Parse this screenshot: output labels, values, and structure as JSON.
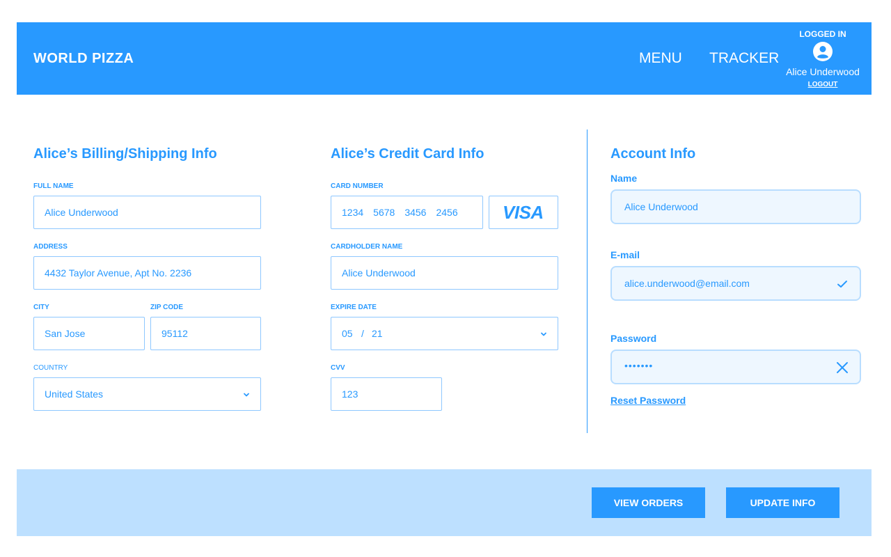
{
  "header": {
    "brand": "WORLD PIZZA",
    "nav": [
      "MENU",
      "TRACKER"
    ],
    "user": {
      "status": "LOGGED IN",
      "avatar_icon": "user-circle-icon",
      "name": "Alice Underwood",
      "logout": "LOGOUT"
    }
  },
  "billing": {
    "title": "Alice’s Billing/Shipping Info",
    "full_name_label": "FULL NAME",
    "full_name": "Alice Underwood",
    "address_label": "ADDRESS",
    "address": "4432 Taylor Avenue, Apt No. 2236",
    "city_label": "CITY",
    "city": "San Jose",
    "zip_label": "ZIP CODE",
    "zip": "95112",
    "country_label": "COUNTRY",
    "country": "United States"
  },
  "credit_card": {
    "title": "Alice’s Credit Card Info",
    "card_number_label": "CARD NUMBER",
    "card_number_groups": [
      "1234",
      "5678",
      "3456",
      "2456"
    ],
    "brand": "VISA",
    "cardholder_label": "CARDHOLDER NAME",
    "cardholder": "Alice Underwood",
    "expire_label": "EXPIRE DATE",
    "expire_month": "05",
    "expire_separator": "/",
    "expire_year": "21",
    "cvv_label": "CVV",
    "cvv": "123"
  },
  "account": {
    "title": "Account Info",
    "name_label": "Name",
    "name": "Alice Underwood",
    "email_label": "E-mail",
    "email": "alice.underwood@email.com",
    "password_label": "Password",
    "password_masked": "•••••••",
    "reset": "Reset Password"
  },
  "footer": {
    "view_orders": "VIEW ORDERS",
    "update_info": "UPDATE INFO"
  },
  "colors": {
    "primary": "#2899ff",
    "footer_bg": "#bde0ff",
    "field_border": "#8ec7ff",
    "account_field_bg": "#eef7ff"
  }
}
